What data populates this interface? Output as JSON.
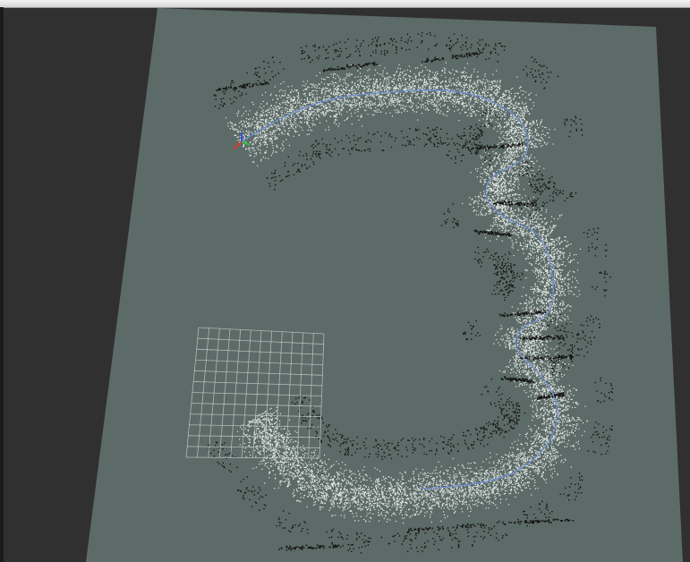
{
  "viewer": {
    "kind": "3d-point-cloud-viewport",
    "colors": {
      "background": "#303030",
      "ground_plane": "#5c6b67",
      "free_space_points": "#e6e9e6",
      "obstacle_points": "#141414",
      "trajectory": "#6e8fd0",
      "grid": "#c9d3d0",
      "axis_x": "#e03a2c",
      "axis_y": "#2fc24a",
      "axis_z": "#3050e0"
    },
    "icons": {
      "origin_axes": "xyz-axes-icon"
    }
  }
}
